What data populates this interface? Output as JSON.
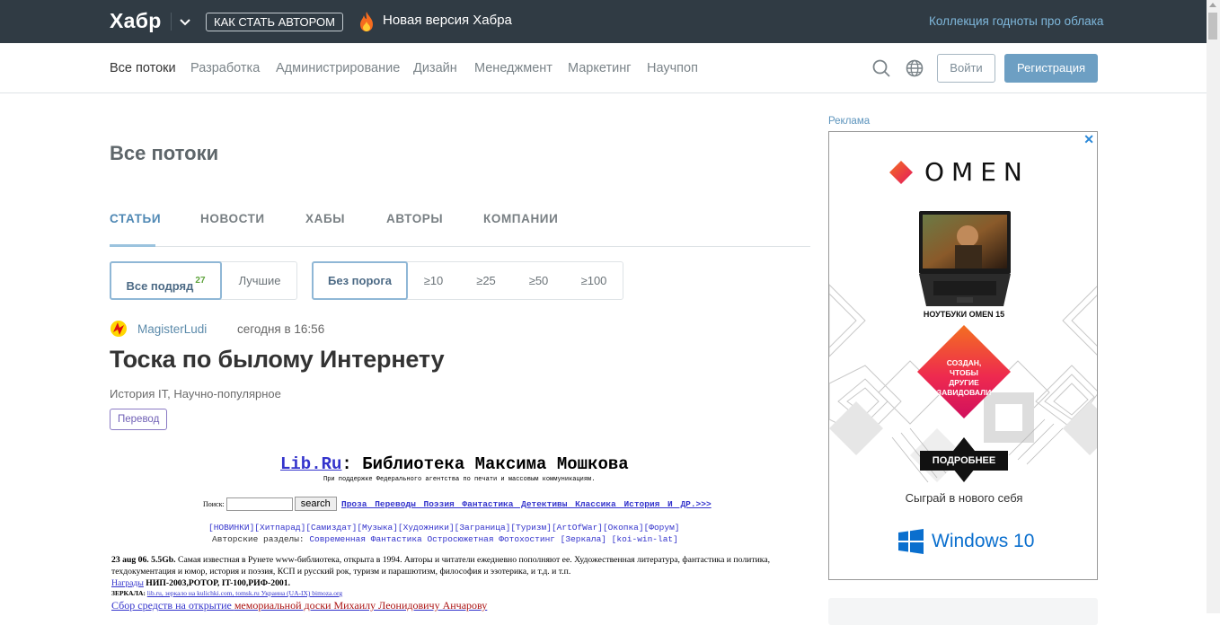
{
  "topbar": {
    "logo": "Хабр",
    "howto_button": "КАК СТАТЬ АВТОРОМ",
    "promo_text": "Новая версия Хабра",
    "right_link": "Коллекция годноты про облака"
  },
  "nav": {
    "items": [
      "Все потоки",
      "Разработка",
      "Администрирование",
      "Дизайн",
      "Менеджмент",
      "Маркетинг",
      "Научпоп"
    ],
    "login": "Войти",
    "register": "Регистрация"
  },
  "page": {
    "title": "Все потоки",
    "tabs": [
      "СТАТЬИ",
      "НОВОСТИ",
      "ХАБЫ",
      "АВТОРЫ",
      "КОМПАНИИ"
    ],
    "filters_left": [
      {
        "label": "Все подряд",
        "badge": "27"
      },
      {
        "label": "Лучшие"
      }
    ],
    "filters_right": [
      "Без порога",
      "≥10",
      "≥25",
      "≥50",
      "≥100"
    ]
  },
  "post": {
    "author": "MagisterLudi",
    "time": "сегодня в 16:56",
    "title": "Тоска по былому Интернету",
    "hubs": "История IT,  Научно-популярное",
    "tag": "Перевод"
  },
  "embed": {
    "site_link": "Lib.Ru",
    "site_title": ": Библиотека Максима Мошкова",
    "subtitle": "При поддержке Федерального агентства по печати и массовым коммуникациям.",
    "search_label": "Поиск:",
    "search_button": "search",
    "categories": "Проза Переводы Поэзия Фантастика Детективы Классика История  И ДР.>>>",
    "categories2": "[НОВИНКИ][Хитпарад][Самиздат][Музыка][Художники][Заграница][Туризм][ArtOfWar][Окопка][Форум]",
    "sections_label": "Авторские разделы:",
    "sections": "Современная Фантастика Остросюжетная Фотохостинг [Зеркала] [koi-win-lat]",
    "text_bold": "23 aug 06. 5.5Gb.",
    "text": "Самая известная в Рунете www-библиотека, открыта в 1994. Авторы и читатели ежедневно пополняют ее. Художественная литература, фантастика и политика, техдокументация и юмор, история и поэзия, КСП и русский рок, туризм и парашютизм, философия и эзотерика, и т.д. и т.п.",
    "awards_link": "Награды",
    "awards": "НИП-2003,РОТОР, IT-100,РИФ-2001.",
    "mirrors_label": "ЗЕРКАЛА:",
    "mirrors": "lib.ru, зеркало на kulichki.com, tomsk.ru Украина (UA-IX) bimoza.org",
    "fund_text": "Сбор средств на открытие ",
    "fund_red": "мемориальной доски Михаилу Леонидовичу Анчарову"
  },
  "ad": {
    "label": "Реклама",
    "close": "✕",
    "brand": "OMEN",
    "laptop_caption": "НОУТБУКИ OMEN 15",
    "diamond_text": "СОЗДАН, ЧТОБЫ ДРУГИЕ ЗАВИДОВАЛИ",
    "more_button": "ПОДРОБНЕЕ",
    "slogan": "Сыграй в нового себя",
    "windows": "Windows 10",
    "colors": {
      "omen_pink": "#e5195e",
      "omen_orange": "#f36f21",
      "windows_blue": "#0a6fce"
    }
  },
  "icons": [
    "chevron-down-icon",
    "fire-icon",
    "search-icon",
    "globe-icon",
    "avatar-icon",
    "close-icon",
    "omen-logo-icon",
    "windows-logo-icon"
  ]
}
